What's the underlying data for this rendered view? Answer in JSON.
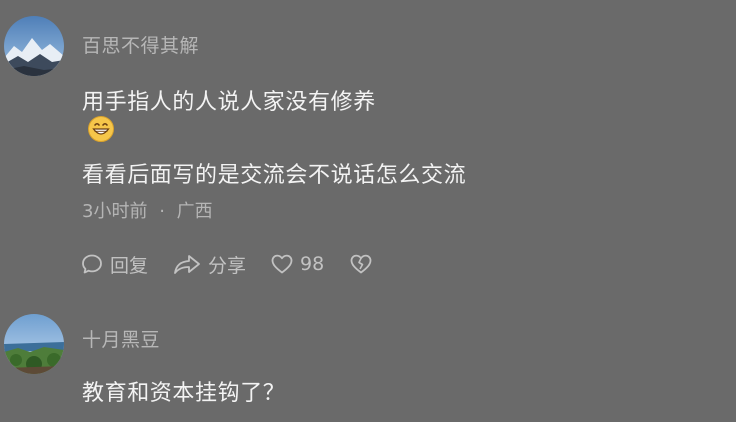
{
  "comments": [
    {
      "username": "百思不得其解",
      "lines": [
        "用手指人的人说人家没有修养",
        "看看后面写的是交流会不说话怎么交流"
      ],
      "emoji": "grinning-face",
      "time": "3小时前",
      "separator": "·",
      "location": "广西",
      "actions": {
        "reply": "回复",
        "share": "分享",
        "likes": "98"
      }
    },
    {
      "username": "十月黑豆",
      "lines": [
        "教育和资本挂钩了？"
      ]
    }
  ],
  "icons": {
    "reply": "speech-bubble-icon",
    "share": "share-arrow-icon",
    "like": "heart-icon",
    "dislike": "broken-heart-icon"
  }
}
